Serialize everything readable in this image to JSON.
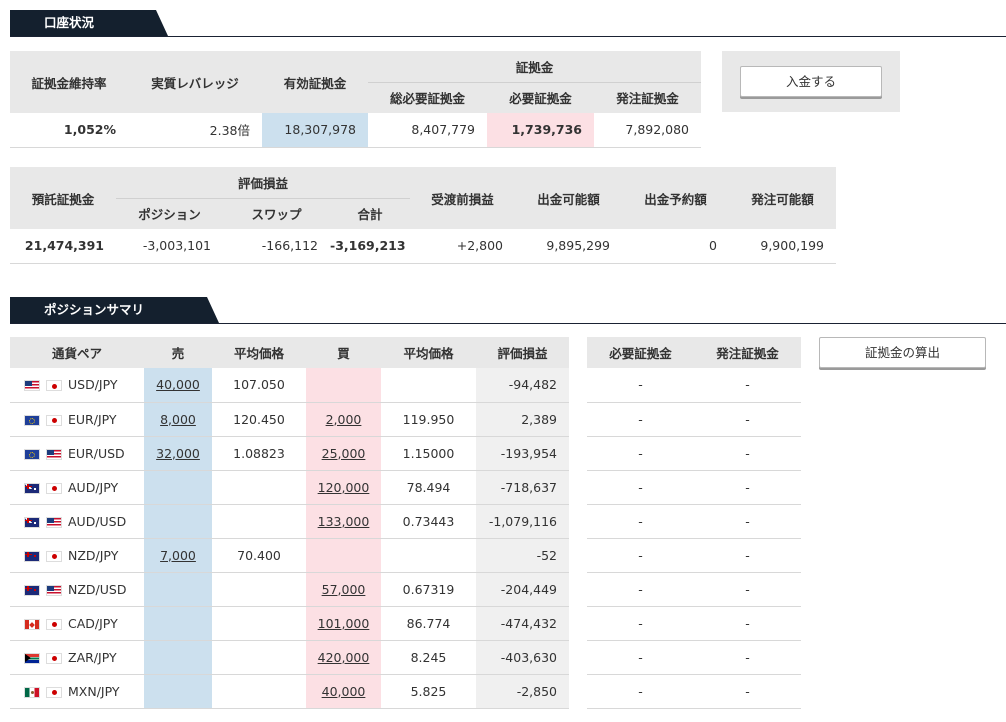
{
  "sections": {
    "account": "口座状況",
    "positions": "ポジションサマリ"
  },
  "account_table": {
    "headers": {
      "maintenance_ratio": "証拠金維持率",
      "leverage": "実質レバレッジ",
      "effective_margin": "有効証拠金",
      "margin_group": "証拠金",
      "total_required": "総必要証拠金",
      "required": "必要証拠金",
      "order_margin": "発注証拠金"
    },
    "values": {
      "maintenance_ratio": "1,052%",
      "leverage": "2.38倍",
      "effective_margin": "18,307,978",
      "total_required": "8,407,779",
      "required": "1,739,736",
      "order_margin": "7,892,080"
    }
  },
  "deposit_button": "入金する",
  "balance_table": {
    "headers": {
      "deposit": "預託証拠金",
      "pl_group": "評価損益",
      "position": "ポジション",
      "swap": "スワップ",
      "total": "合計",
      "pre_settle": "受渡前損益",
      "withdrawable": "出金可能額",
      "withdraw_reserved": "出金予約額",
      "orderable": "発注可能額"
    },
    "values": {
      "deposit": "21,474,391",
      "position": "-3,003,101",
      "swap": "-166,112",
      "total": "-3,169,213",
      "pre_settle": "+2,800",
      "withdrawable": "9,895,299",
      "withdraw_reserved": "0",
      "orderable": "9,900,199"
    }
  },
  "positions_table": {
    "headers": {
      "pair": "通貨ペア",
      "sell": "売",
      "sell_avg": "平均価格",
      "buy": "買",
      "buy_avg": "平均価格",
      "pl": "評価損益"
    },
    "rows": [
      {
        "pair": "USD/JPY",
        "sell": "40,000",
        "sell_avg": "107.050",
        "buy": "",
        "buy_avg": "",
        "pl": "-94,482"
      },
      {
        "pair": "EUR/JPY",
        "sell": "8,000",
        "sell_avg": "120.450",
        "buy": "2,000",
        "buy_avg": "119.950",
        "pl": "2,389"
      },
      {
        "pair": "EUR/USD",
        "sell": "32,000",
        "sell_avg": "1.08823",
        "buy": "25,000",
        "buy_avg": "1.15000",
        "pl": "-193,954"
      },
      {
        "pair": "AUD/JPY",
        "sell": "",
        "sell_avg": "",
        "buy": "120,000",
        "buy_avg": "78.494",
        "pl": "-718,637"
      },
      {
        "pair": "AUD/USD",
        "sell": "",
        "sell_avg": "",
        "buy": "133,000",
        "buy_avg": "0.73443",
        "pl": "-1,079,116"
      },
      {
        "pair": "NZD/JPY",
        "sell": "7,000",
        "sell_avg": "70.400",
        "buy": "",
        "buy_avg": "",
        "pl": "-52"
      },
      {
        "pair": "NZD/USD",
        "sell": "",
        "sell_avg": "",
        "buy": "57,000",
        "buy_avg": "0.67319",
        "pl": "-204,449"
      },
      {
        "pair": "CAD/JPY",
        "sell": "",
        "sell_avg": "",
        "buy": "101,000",
        "buy_avg": "86.774",
        "pl": "-474,432"
      },
      {
        "pair": "ZAR/JPY",
        "sell": "",
        "sell_avg": "",
        "buy": "420,000",
        "buy_avg": "8.245",
        "pl": "-403,630"
      },
      {
        "pair": "MXN/JPY",
        "sell": "",
        "sell_avg": "",
        "buy": "40,000",
        "buy_avg": "5.825",
        "pl": "-2,850"
      }
    ]
  },
  "margin_table": {
    "headers": {
      "required": "必要証拠金",
      "order": "発注証拠金"
    },
    "placeholder": "-"
  },
  "calc_button": "証拠金の算出",
  "flags": {
    "USD": "us-flag-icon",
    "JPY": "jp-flag-icon",
    "EUR": "eu-flag-icon",
    "AUD": "au-flag-icon",
    "NZD": "nz-flag-icon",
    "CAD": "ca-flag-icon",
    "ZAR": "za-flag-icon",
    "MXN": "mx-flag-icon"
  }
}
